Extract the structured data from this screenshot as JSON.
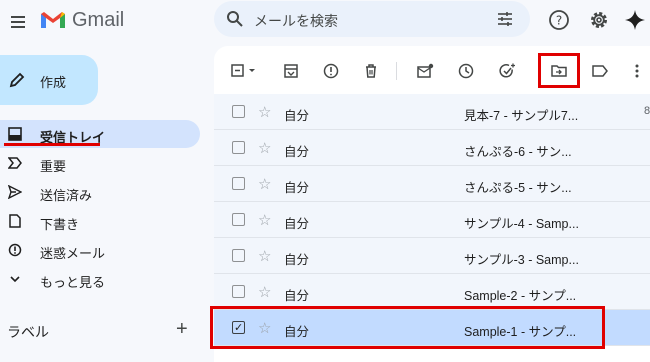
{
  "header": {
    "app_name": "Gmail",
    "search_placeholder": "メールを検索"
  },
  "sidebar": {
    "compose_label": "作成",
    "items": [
      {
        "label": "受信トレイ",
        "icon": "inbox-icon"
      },
      {
        "label": "重要",
        "icon": "important-icon"
      },
      {
        "label": "送信済み",
        "icon": "sent-icon"
      },
      {
        "label": "下書き",
        "icon": "draft-icon"
      },
      {
        "label": "迷惑メール",
        "icon": "spam-icon"
      },
      {
        "label": "もっと見る",
        "icon": "chevron-down-icon"
      }
    ],
    "labels_title": "ラベル",
    "labels_add": "+"
  },
  "toolbar": {
    "icons": [
      "select-checkbox-icon",
      "archive-icon",
      "report-spam-icon",
      "delete-icon",
      "mark-unread-icon",
      "snooze-icon",
      "add-task-icon",
      "move-to-icon",
      "label-icon",
      "more-icon"
    ]
  },
  "messages": [
    {
      "sender": "自分",
      "subject": "見本-7 - サンプル7...",
      "extra": "8",
      "selected": false
    },
    {
      "sender": "自分",
      "subject": "さんぷる-6 - サン...",
      "extra": "",
      "selected": false
    },
    {
      "sender": "自分",
      "subject": "さんぷる-5 - サン...",
      "extra": "",
      "selected": false
    },
    {
      "sender": "自分",
      "subject": "サンプル-4 - Samp...",
      "extra": "",
      "selected": false
    },
    {
      "sender": "自分",
      "subject": "サンプル-3 - Samp...",
      "extra": "",
      "selected": false
    },
    {
      "sender": "自分",
      "subject": "Sample-2 - サンプ...",
      "extra": "",
      "selected": false
    },
    {
      "sender": "自分",
      "subject": "Sample-1 - サンプ...",
      "extra": "",
      "selected": true
    }
  ],
  "colors": {
    "accent": "#c2e7ff",
    "active_nav": "#d3e3fd",
    "selected_row": "#c2dbff",
    "highlight": "#e00000"
  }
}
